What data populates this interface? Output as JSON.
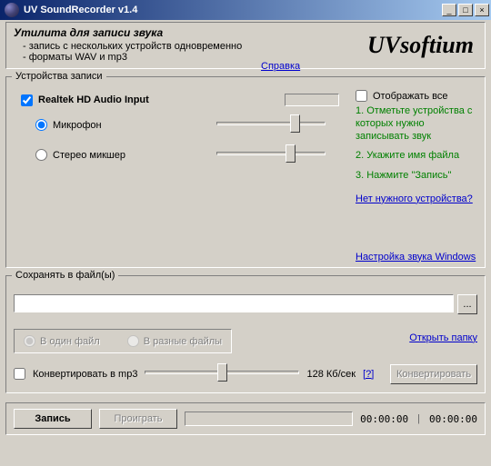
{
  "titlebar": {
    "title": "UV SoundRecorder v1.4"
  },
  "header": {
    "title": "Утилита для записи звука",
    "bullets": [
      "запись с нескольких устройств одновременно",
      "форматы WAV и mp3"
    ],
    "help": "Справка",
    "brand": "UVsoftium"
  },
  "devices": {
    "legend": "Устройства записи",
    "show_all": "Отображать все",
    "device_name": "Realtek HD Audio Input",
    "input_mic": "Микрофон",
    "input_mixer": "Стерео микшер",
    "steps": [
      "1. Отметьте устройства с которых нужно записывать звук",
      "2. Укажите имя файла",
      "3. Нажмите \"Запись\""
    ],
    "no_device": "Нет нужного устройства?",
    "win_sound": "Настройка звука Windows"
  },
  "save": {
    "legend": "Сохранять в файл(ы)",
    "path": "",
    "browse": "...",
    "one_file": "В один файл",
    "multi_file": "В разные файлы",
    "open_folder": "Открыть папку"
  },
  "mp3": {
    "convert_label": "Конвертировать в mp3",
    "bitrate": "128 Кб/сек",
    "help": "[?]",
    "convert_btn": "Конвертировать"
  },
  "bottom": {
    "record": "Запись",
    "play": "Проиграть",
    "time_elapsed": "00:00:00",
    "time_total": "00:00:00"
  }
}
